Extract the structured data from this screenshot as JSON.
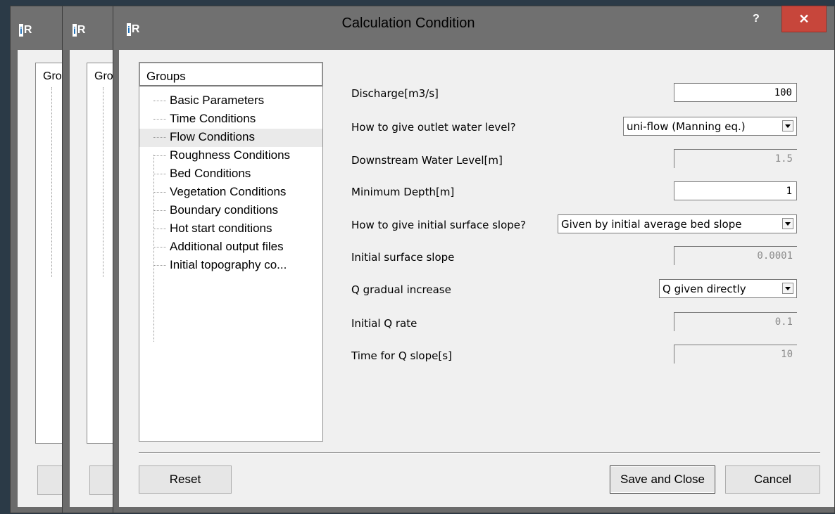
{
  "dialog": {
    "title": "Calculation Condition",
    "help": "?",
    "close": "✕"
  },
  "background_windows": {
    "tree_header_1": "Gro",
    "tree_header_2": "Gro"
  },
  "tree": {
    "header": "Groups",
    "items": [
      {
        "label": "Basic Parameters"
      },
      {
        "label": "Time Conditions"
      },
      {
        "label": "Flow Conditions"
      },
      {
        "label": "Roughness Conditions"
      },
      {
        "label": "Bed Conditions"
      },
      {
        "label": "Vegetation Conditions"
      },
      {
        "label": "Boundary conditions"
      },
      {
        "label": "Hot start conditions"
      },
      {
        "label": "Additional output files"
      },
      {
        "label": "Initial topography co..."
      }
    ],
    "selected": "Flow Conditions"
  },
  "form": {
    "discharge": {
      "label": "Discharge[m3/s]",
      "value": "100"
    },
    "outlet_method": {
      "label": "How to give outlet water level?",
      "value": "uni-flow (Manning eq.)"
    },
    "downstream_level": {
      "label": "Downstream Water Level[m]",
      "value": "1.5"
    },
    "min_depth": {
      "label": "Minimum Depth[m]",
      "value": "1"
    },
    "slope_method": {
      "label": "How to give initial surface slope?",
      "value": "Given by initial average bed slope"
    },
    "initial_slope": {
      "label": "Initial surface slope",
      "value": "0.0001"
    },
    "q_increase": {
      "label": "Q gradual increase",
      "value": "Q given directly"
    },
    "initial_q_rate": {
      "label": "Initial Q rate",
      "value": "0.1"
    },
    "q_slope_time": {
      "label": "Time for Q slope[s]",
      "value": "10"
    }
  },
  "buttons": {
    "reset": "Reset",
    "save_close": "Save and Close",
    "cancel": "Cancel"
  }
}
